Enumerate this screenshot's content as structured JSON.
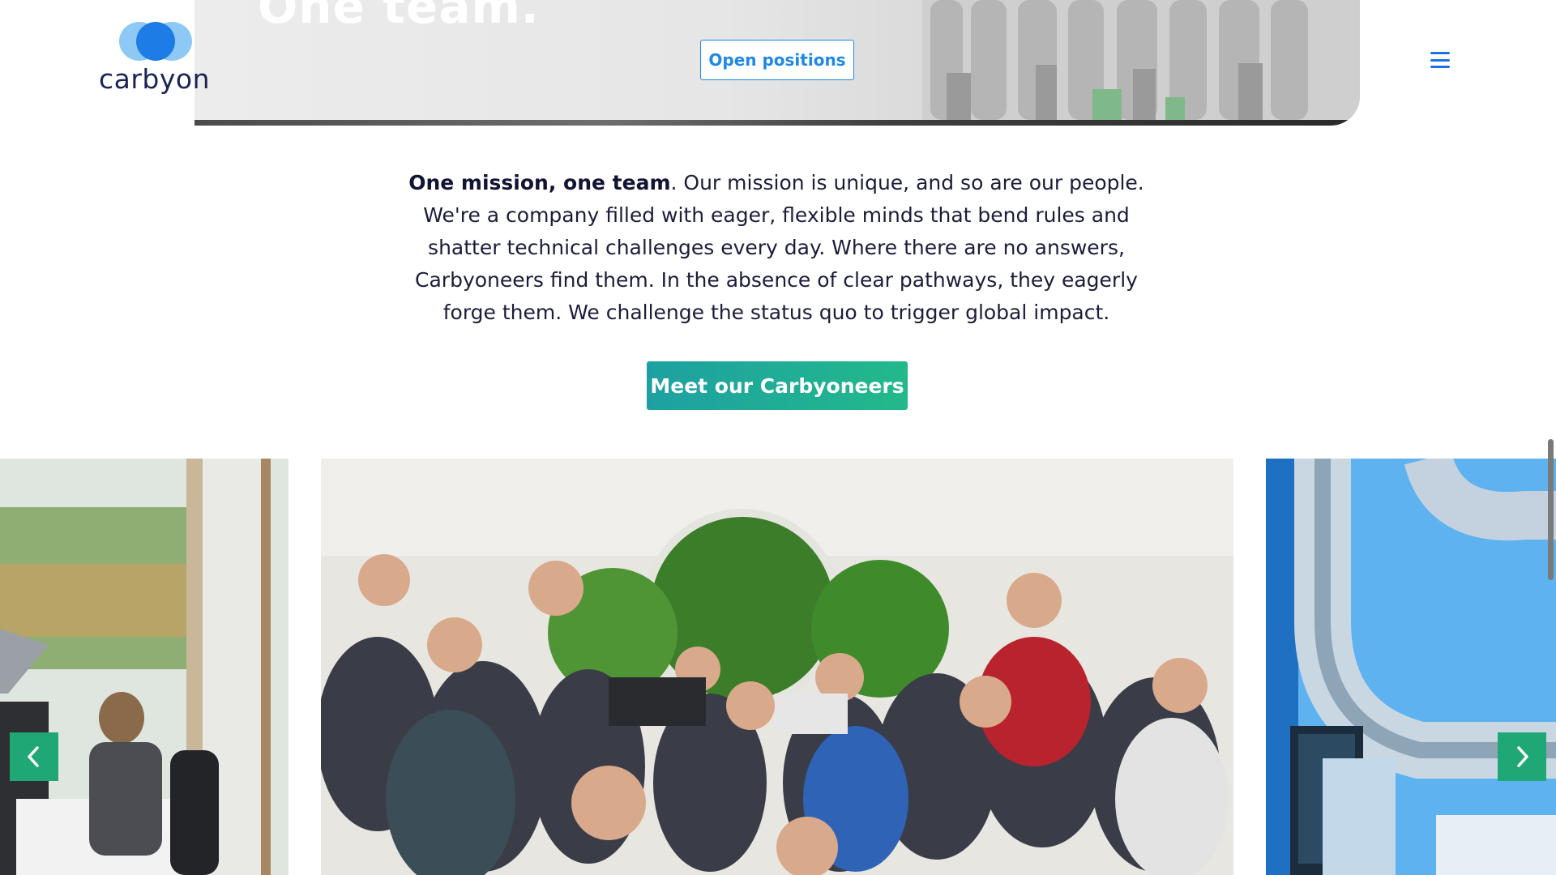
{
  "header": {
    "logo_text": "carbyon",
    "menu_icon": "hamburger-menu-icon"
  },
  "hero": {
    "title": "One team.",
    "open_positions_label": "Open positions"
  },
  "intro": {
    "lead": "One mission, one team",
    "body": ". Our mission is unique, and so are our people. We're a company filled with eager, flexible minds that bend rules and shatter technical challenges every day. Where there are no answers, Carbyoneers find them. In the absence of clear pathways, they eagerly forge them. We challenge the status quo to trigger global impact."
  },
  "cta": {
    "meet_label": "Meet our Carbyoneers"
  },
  "carousel": {
    "prev_icon": "chevron-left-icon",
    "next_icon": "chevron-right-icon",
    "slides": [
      "office-window-photo",
      "team-meeting-photo",
      "lab-pipes-photo"
    ]
  },
  "colors": {
    "brand_blue": "#1e88e5",
    "brand_green": "#22b98a",
    "text_dark": "#1b1d3b"
  }
}
